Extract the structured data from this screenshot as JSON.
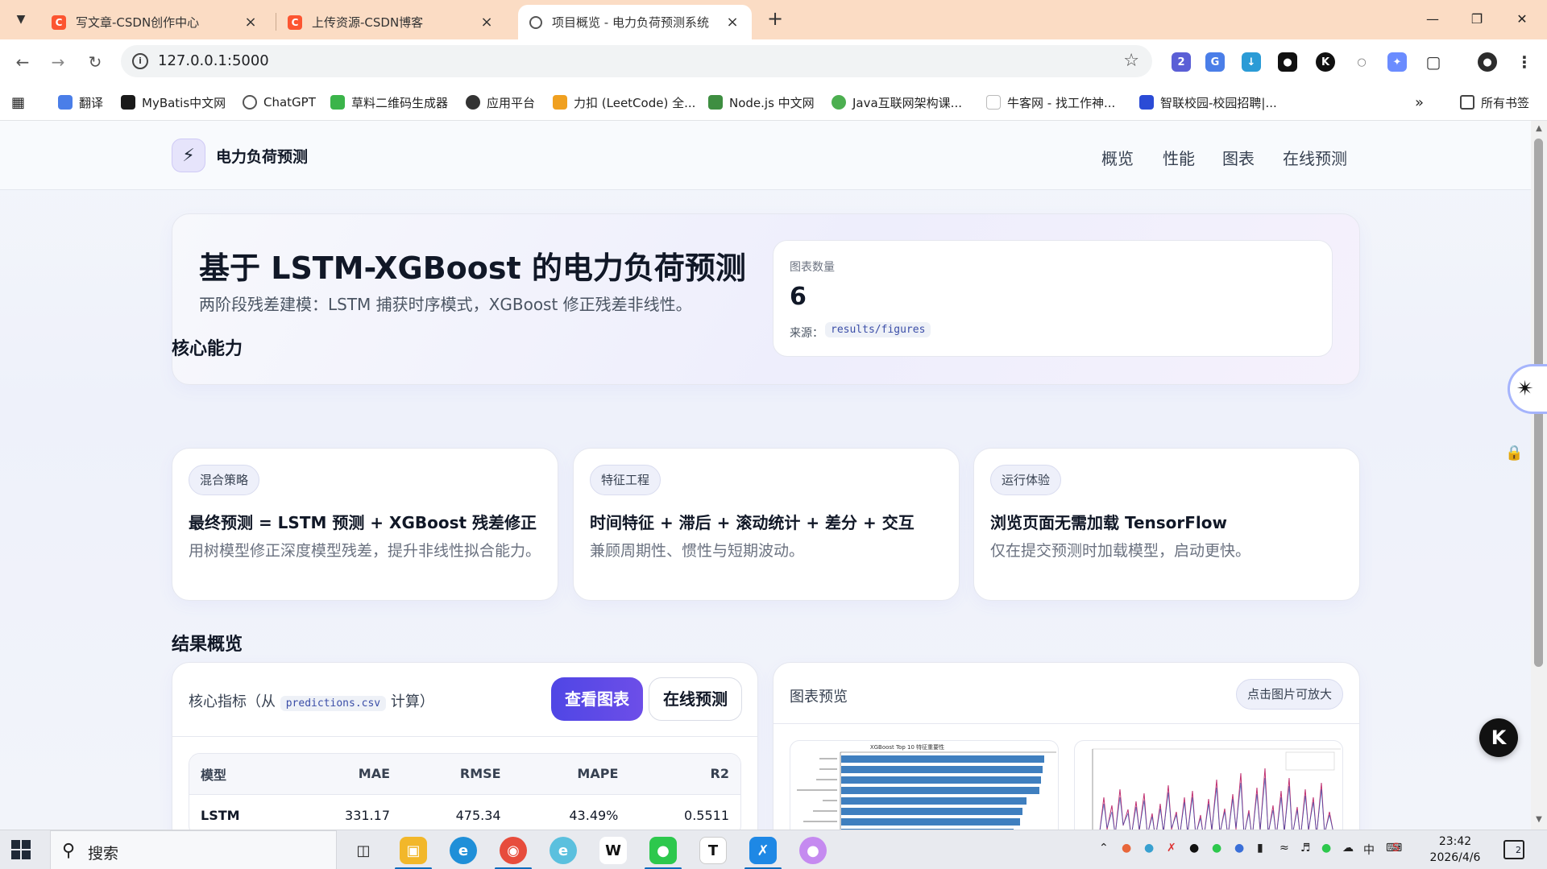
{
  "browser": {
    "tabs": [
      {
        "title": "写文章-CSDN创作中心",
        "icon": "csdn-icon"
      },
      {
        "title": "上传资源-CSDN博客",
        "icon": "csdn-icon"
      },
      {
        "title": "项目概览 - 电力负荷预测系统",
        "icon": "globe-icon"
      }
    ],
    "url": "127.0.0.1:5000",
    "extension_badge": "2",
    "bookmarks": [
      "翻译",
      "MyBatis中文网",
      "ChatGPT",
      "草料二维码生成器",
      "应用平台",
      "力扣 (LeetCode) 全...",
      "Node.js 中文网",
      "Java互联网架构课...",
      "牛客网 - 找工作神...",
      "智联校园-校园招聘|..."
    ],
    "all_bookmarks": "所有书签"
  },
  "site": {
    "brand": "电力负荷预测",
    "nav": [
      "概览",
      "性能",
      "图表",
      "在线预测"
    ]
  },
  "hero": {
    "title": "基于 LSTM-XGBoost 的电力负荷预测",
    "subtitle": "两阶段残差建模：LSTM 捕获时序模式，XGBoost 修正残差非线性。",
    "stat_label": "图表数量",
    "stat_value": "6",
    "source_label": "来源：",
    "source_path": "results/figures"
  },
  "capabilities": {
    "title": "核心能力",
    "cards": [
      {
        "tag": "混合策略",
        "title": "最终预测 = LSTM 预测 + XGBoost 残差修正",
        "desc": "用树模型修正深度模型残差，提升非线性拟合能力。"
      },
      {
        "tag": "特征工程",
        "title": "时间特征 + 滞后 + 滚动统计 + 差分 + 交互",
        "desc": "兼顾周期性、惯性与短期波动。"
      },
      {
        "tag": "运行体验",
        "title": "浏览页面无需加载 TensorFlow",
        "desc": "仅在提交预测时加载模型，启动更快。"
      }
    ]
  },
  "results": {
    "title": "结果概览",
    "metrics_label_pre": "核心指标（从",
    "metrics_file": "predictions.csv",
    "metrics_label_post": "计算）",
    "btn_charts": "查看图表",
    "btn_predict": "在线预测",
    "table": {
      "headers": [
        "模型",
        "MAE",
        "RMSE",
        "MAPE",
        "R2"
      ],
      "rows": [
        [
          "LSTM",
          "331.17",
          "475.34",
          "43.49%",
          "0.5511"
        ]
      ]
    },
    "preview_label": "图表预览",
    "preview_hint": "点击图片可放大",
    "thumb1_title": "XGBoost Top 10 特征重要性"
  },
  "taskbar": {
    "search": "搜索",
    "time": "23:42",
    "date": "2026/4/6",
    "ime": "中",
    "notifications": "2"
  },
  "colors": {
    "tab_strip": "#fbdcc4",
    "accent": "#4f46e5",
    "csdn": "#fc5531"
  }
}
